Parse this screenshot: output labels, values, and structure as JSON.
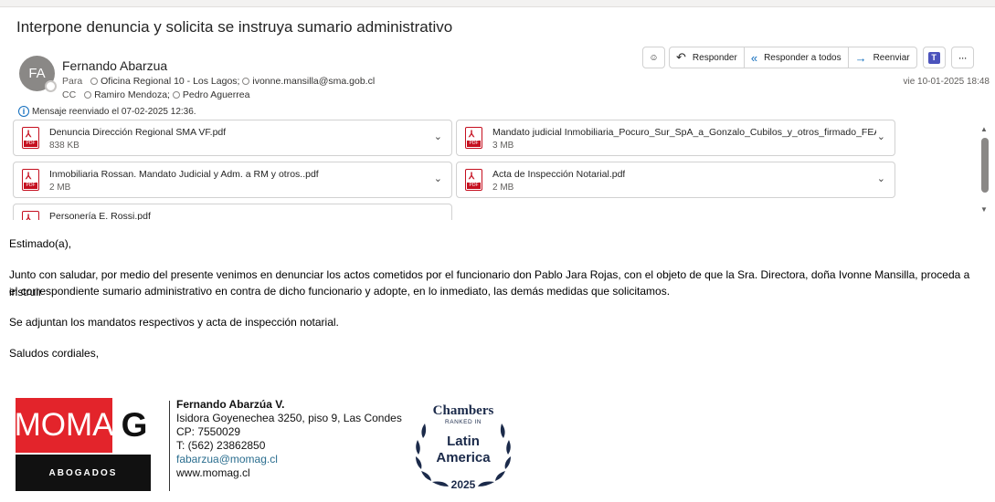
{
  "email": {
    "subject": "Interpone denuncia y solicita se instruya sumario administrativo",
    "sender": {
      "initials": "FA",
      "name": "Fernando Abarzua"
    },
    "to_label": "Para",
    "to": [
      "Oficina Regional 10 - Los Lagos;",
      "ivonne.mansilla@sma.gob.cl"
    ],
    "cc_label": "CC",
    "cc": [
      "Ramiro Mendoza;",
      "Pedro Aguerrea"
    ],
    "forwarded_notice": "Mensaje reenviado el 07-02-2025 12:36.",
    "date": "vie 10-01-2025 18:48"
  },
  "toolbar": {
    "reply": "Responder",
    "reply_all": "Responder a todos",
    "forward": "Reenviar",
    "teams_letter": "T",
    "more": "···"
  },
  "attachments": [
    {
      "name": "Denuncia Dirección Regional SMA VF.pdf",
      "size": "838 KB"
    },
    {
      "name": "Mandato judicial Inmobiliaria_Pocuro_Sur_SpA_a_Gonzalo_Cubilos_y_otros_firmado_FEA_.pdf",
      "size": "3 MB"
    },
    {
      "name": "Inmobiliaria Rossan. Mandato Judicial y Adm. a RM y otros..pdf",
      "size": "2 MB"
    },
    {
      "name": "Acta de Inspección Notarial.pdf",
      "size": "2 MB"
    },
    {
      "name": "Personería E. Rossi.pdf",
      "size": ""
    }
  ],
  "pdf_tag": "PDF",
  "body": {
    "greeting": "Estimado(a),",
    "p1_line1": "Junto con saludar, por medio del presente venimos en denunciar los actos cometidos por el funcionario don Pablo Jara Rojas, con el objeto de que la Sra. Directora, doña Ivonne Mansilla, proceda a instruir",
    "p1_line2": "el correspondiente sumario administrativo en contra de dicho funcionario y adopte, en lo inmediato, las demás medidas que solicitamos.",
    "p2": "Se adjuntan los mandatos respectivos y acta de inspección notarial.",
    "closing": "Saludos cordiales,"
  },
  "signature": {
    "logo_main": "MOMA",
    "logo_g": "G",
    "logo_sub": "ABOGADOS",
    "name": "Fernando Abarzúa V.",
    "address": "Isidora Goyenechea 3250, piso 9, Las Condes",
    "cp": "CP: 7550029",
    "phone": "T: (562) 23862850",
    "email": "fabarzua@momag.cl",
    "web": "www.momag.cl"
  },
  "chambers": {
    "brand": "Chambers",
    "ranked": "RANKED IN",
    "region_1": "Latin",
    "region_2": "America",
    "year": "2025"
  },
  "colors": {
    "accent": "#0f6cbd",
    "moma_red": "#e3242b",
    "pdf_red": "#c50f1f"
  }
}
